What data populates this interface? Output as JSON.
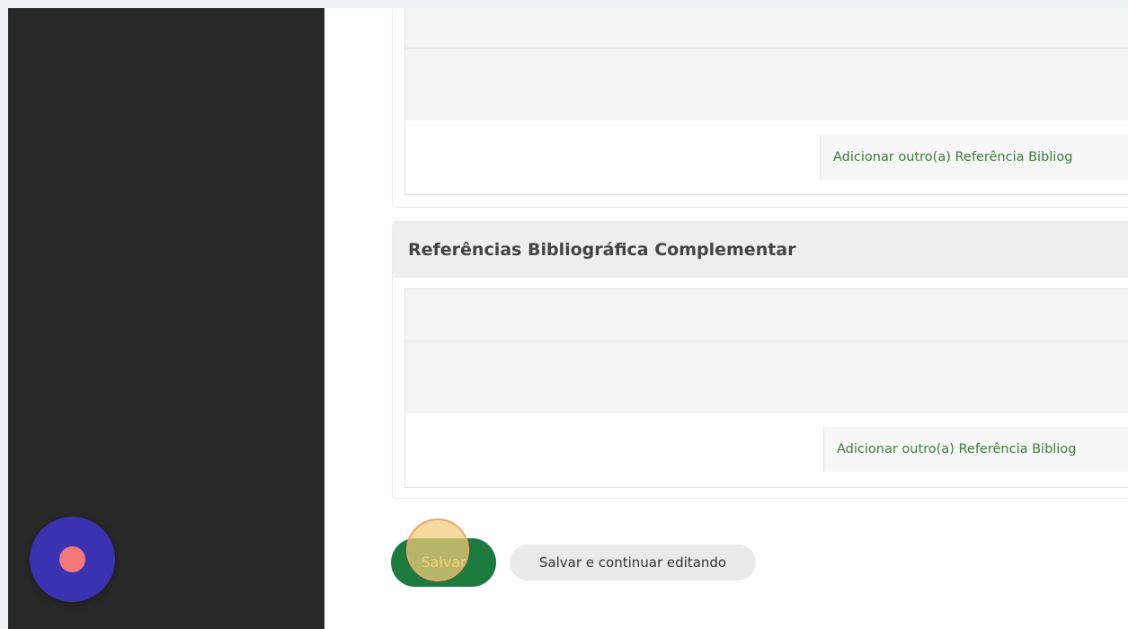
{
  "inline_top": {
    "add_link_label": "Adicionar outro(a) Referência Bibliog"
  },
  "inline_complementar": {
    "title": "Referências Bibliográfica Complementar",
    "add_link_label": "Adicionar outro(a) Referência Bibliog"
  },
  "submit_row": {
    "save_label": "Salvar",
    "save_continue_label": "Salvar e continuar editando"
  },
  "colors": {
    "sidebar": "#282828",
    "save_button": "#1c7a3f",
    "link_green": "#3e7a3e",
    "record_button": "#3a32b0",
    "record_dot": "#f4787a"
  },
  "icons": {
    "record_button": "record-icon",
    "click_indicator": "click-highlight"
  }
}
